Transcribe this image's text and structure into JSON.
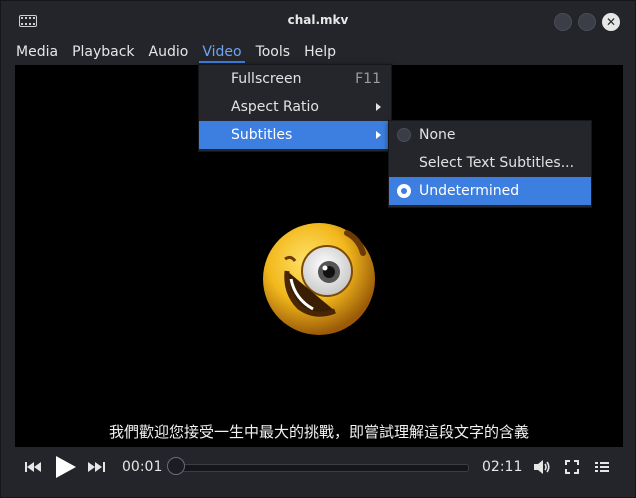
{
  "window": {
    "title": "chal.mkv"
  },
  "menubar": {
    "items": [
      {
        "label": "Media"
      },
      {
        "label": "Playback"
      },
      {
        "label": "Audio"
      },
      {
        "label": "Video"
      },
      {
        "label": "Tools"
      },
      {
        "label": "Help"
      }
    ]
  },
  "video_menu": {
    "items": [
      {
        "label": "Fullscreen",
        "shortcut": "F11"
      },
      {
        "label": "Aspect Ratio"
      },
      {
        "label": "Subtitles"
      }
    ]
  },
  "subtitles_menu": {
    "items": [
      {
        "label": "None"
      },
      {
        "label": "Select Text Subtitles..."
      },
      {
        "label": "Undetermined"
      }
    ]
  },
  "video": {
    "subtitle_text": "我們歡迎您接受一生中最大的挑戰，即嘗試理解這段文字的含義"
  },
  "controls": {
    "elapsed": "00:01",
    "duration": "02:11"
  },
  "colors": {
    "accent": "#3d7fe0",
    "background": "#23252b"
  }
}
